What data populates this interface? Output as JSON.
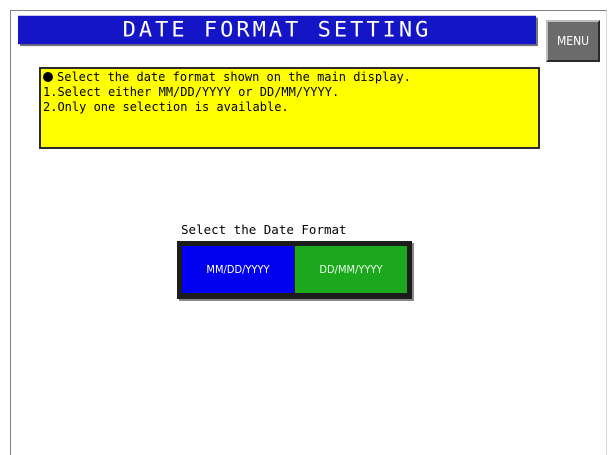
{
  "header": {
    "title": "DATE FORMAT SETTING",
    "menu_label": "MENU"
  },
  "instructions": {
    "lines": [
      "Select the date format shown on the main display.",
      "1.Select either MM/DD/YYYY or DD/MM/YYYY.",
      "2.Only one selection is available."
    ]
  },
  "date_format": {
    "label": "Select the Date Format",
    "options": [
      {
        "label": "MM/DD/YYYY",
        "color": "#0000ee",
        "selected": true
      },
      {
        "label": "DD/MM/YYYY",
        "color": "#1ca81c",
        "selected": false
      }
    ]
  },
  "colors": {
    "title_bar": "#1515c8",
    "info_box": "#ffff00",
    "menu_button": "#6b6b6b"
  }
}
